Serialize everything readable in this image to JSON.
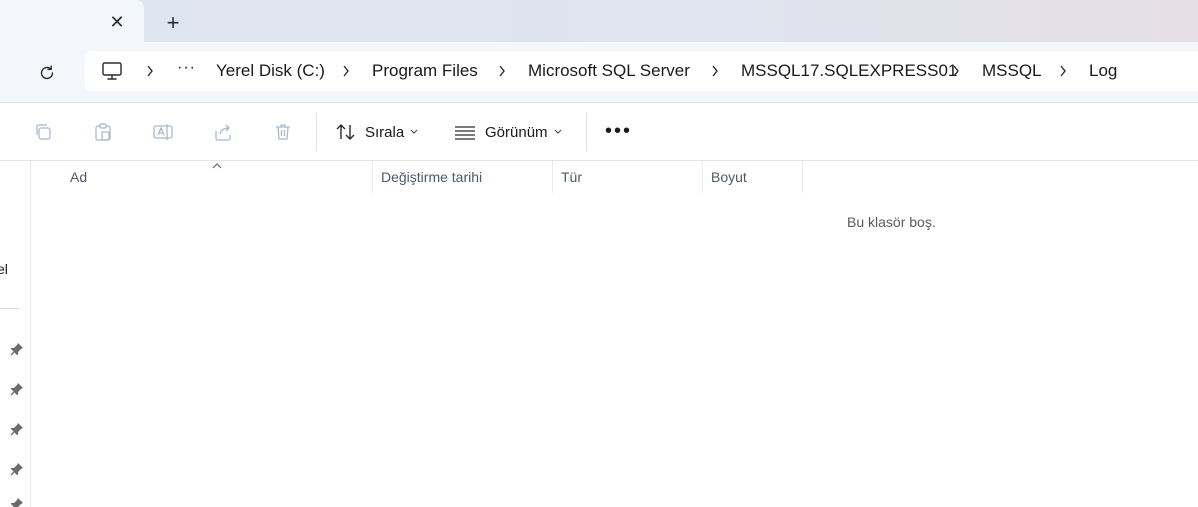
{
  "tabbar": {
    "close_label": "✕",
    "new_tab_label": "+"
  },
  "address": {
    "more_label": "···",
    "breadcrumbs": [
      "Yerel Disk (C:)",
      "Program Files",
      "Microsoft SQL Server",
      "MSSQL17.SQLEXPRESS01",
      "MSSQL",
      "Log"
    ]
  },
  "toolbar": {
    "sort_label": "Sırala",
    "view_label": "Görünüm",
    "more_label": "•••"
  },
  "nav": {
    "partial_label": "el"
  },
  "columns": {
    "name": "Ad",
    "modified": "Değiştirme tarihi",
    "type": "Tür",
    "size": "Boyut"
  },
  "content": {
    "empty_message": "Bu klasör boş."
  },
  "colors": {
    "accent": "#0067c0",
    "icon_disabled": "#a9b9cc",
    "header_text": "#4c5a6a"
  }
}
